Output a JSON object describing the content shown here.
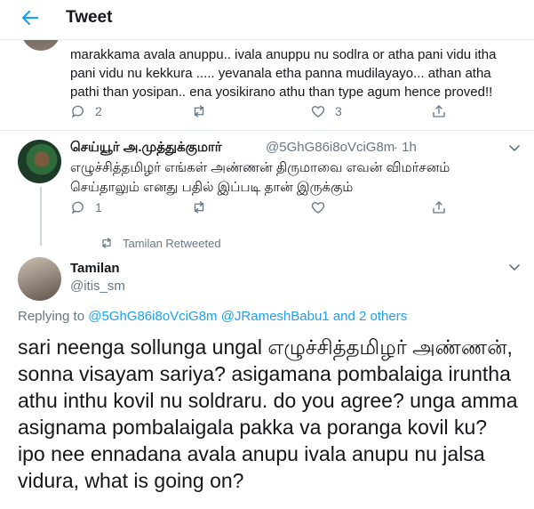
{
  "header": {
    "title": "Tweet"
  },
  "previous_tweet": {
    "text_tail": "marakkama  avala anuppu.. ivala anuppu nu sodlra or atha pani vidu itha pani vidu nu kekkura ..... yevanala etha panna mudilayayo... athan atha pathi than yosipan.. ena yosikirano athu than type agum hence proved!!",
    "reply_count": "2",
    "retweet_count": "",
    "like_count": "3"
  },
  "reply_tweet": {
    "display_name": "செய்யூர் அ.முத்துக்குமார்",
    "handle": "@5GhG86i8oVciG8m",
    "time": "· 1h",
    "text": "எழுச்சித்தமிழர் எங்கள் அண்ணன் திருமாவை எவன் விமர்சனம் செய்தாலும் எனது பதில் இப்படி தான் இருக்கும்",
    "reply_count": "1",
    "retweet_count": "",
    "like_count": ""
  },
  "retweet_context": {
    "label": "Tamilan Retweeted"
  },
  "main_tweet": {
    "display_name": "Tamilan",
    "handle": "@itis_sm",
    "replying_prefix": "Replying to",
    "mention_1": "@5GhG86i8oVciG8m",
    "mention_2": "@JRameshBabu1",
    "mention_tail": "and 2 others",
    "text": "sari neenga sollunga ungal எழுச்சித்தமிழர் அண்ணன், sonna visayam sariya? asigamana pombalaiga iruntha athu inthu kovil nu soldraru. do you agree? unga amma asignama pombalaigala pakka va poranga kovil ku? ipo nee ennadana avala anupu ivala anupu nu jalsa vidura, what is going on?"
  },
  "icons": {
    "back": "arrow-left-icon",
    "reply": "speech-bubble-icon",
    "retweet": "retweet-arrows-icon",
    "like": "heart-icon",
    "share": "share-upload-icon",
    "more": "chevron-down-icon"
  },
  "colors": {
    "accent": "#1da1f2",
    "secondary_text": "#657786",
    "border": "#e6ecf0"
  }
}
